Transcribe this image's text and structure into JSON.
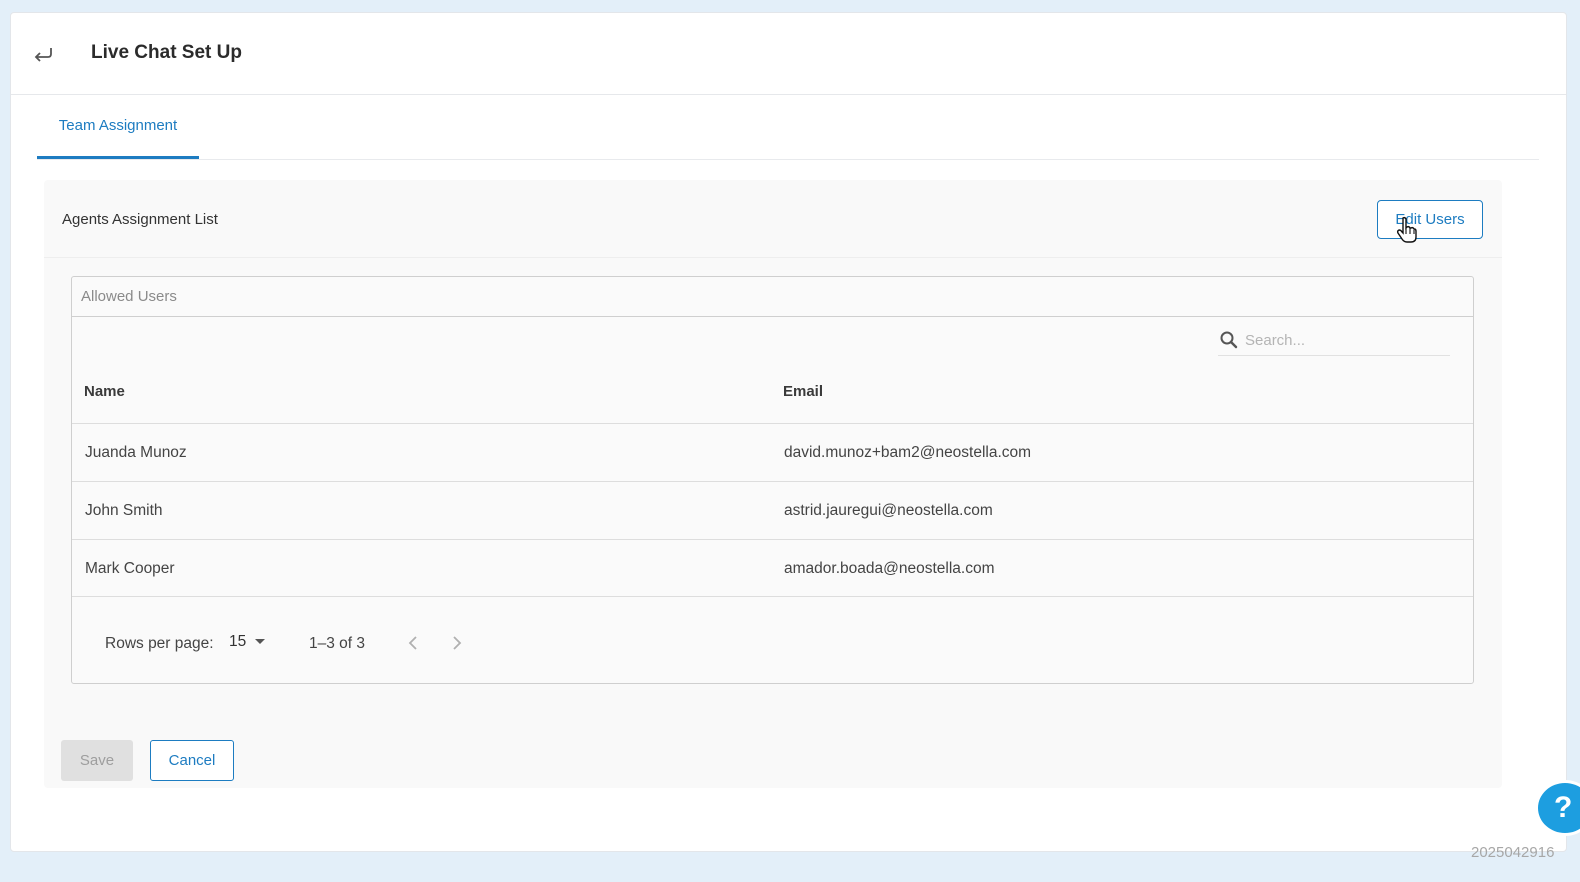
{
  "header": {
    "title": "Live Chat Set Up",
    "back_icon": "return-arrow-icon"
  },
  "tabs": [
    {
      "label": "Team Assignment",
      "active": true
    }
  ],
  "panel": {
    "title": "Agents Assignment List",
    "edit_label": "Edit Users"
  },
  "users_table": {
    "title": "Allowed Users",
    "search_placeholder": "Search...",
    "columns": [
      "Name",
      "Email"
    ],
    "rows": [
      {
        "name": "Juanda Munoz",
        "email": "david.munoz+bam2@neostella.com"
      },
      {
        "name": "John Smith",
        "email": "astrid.jauregui@neostella.com"
      },
      {
        "name": "Mark Cooper",
        "email": "amador.boada@neostella.com"
      }
    ],
    "pagination": {
      "rows_per_page_label": "Rows per page:",
      "rows_per_page": "15",
      "range": "1–3 of 3"
    }
  },
  "actions": {
    "save_label": "Save",
    "save_disabled": true,
    "cancel_label": "Cancel"
  },
  "help": {
    "label": "?"
  },
  "build_id": "2025042916",
  "colors": {
    "accent": "#1d7cc1",
    "background": "#e3eff9",
    "help_fab": "#1d9ee0"
  }
}
